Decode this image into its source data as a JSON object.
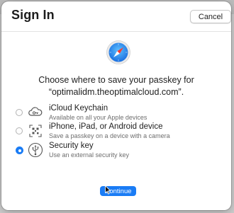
{
  "dialog": {
    "title": "Sign In",
    "cancel_label": "Cancel",
    "prompt_line1": "Choose where to save your passkey for",
    "prompt_line2": "“optimalidm.theoptimalcloud.com”.",
    "continue_label": "Continue"
  },
  "options": [
    {
      "title": "iCloud Keychain",
      "subtitle": "Available on all your Apple devices",
      "icon": "key-cloud-icon",
      "selected": false
    },
    {
      "title": "iPhone, iPad, or Android device",
      "subtitle": "Save a passkey on a device with a camera",
      "icon": "qr-code-icon",
      "selected": false
    },
    {
      "title": "Security key",
      "subtitle": "Use an external security key",
      "icon": "usb-icon",
      "selected": true
    }
  ],
  "colors": {
    "accent": "#1a7cf5",
    "safari_blue": "#1f8af0"
  }
}
